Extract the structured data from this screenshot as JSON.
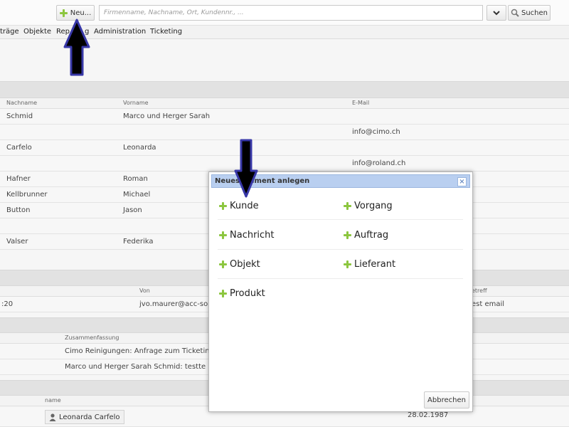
{
  "toolbar": {
    "new_label": "Neu...",
    "search_placeholder": "Firmenname, Nachname, Ort, Kundennr., ...",
    "search_label": "Suchen"
  },
  "menu": {
    "items": [
      "träge",
      "Objekte",
      "Rep",
      "g",
      "Administration",
      "Ticketing"
    ]
  },
  "customers": {
    "headers": {
      "nachname": "Nachname",
      "vorname": "Vorname",
      "email": "E-Mail"
    },
    "rows": [
      {
        "nachname": "Schmid",
        "vorname": "Marco und Herger Sarah",
        "email": ""
      },
      {
        "nachname": "",
        "vorname": "",
        "email": "info@cimo.ch"
      },
      {
        "nachname": "Carfelo",
        "vorname": "Leonarda",
        "email": ""
      },
      {
        "nachname": "",
        "vorname": "",
        "email": "info@roland.ch"
      },
      {
        "nachname": "Hafner",
        "vorname": "Roman",
        "email": ""
      },
      {
        "nachname": "Kellbrunner",
        "vorname": "Michael",
        "email": ""
      },
      {
        "nachname": "Button",
        "vorname": "Jason",
        "email": ""
      },
      {
        "nachname": "",
        "vorname": "",
        "email": ""
      },
      {
        "nachname": "Valser",
        "vorname": "Federika",
        "email": ""
      }
    ]
  },
  "emails": {
    "headers": {
      "von": "Von",
      "betreff": "etreff"
    },
    "row": {
      "time": ":20",
      "von": "jvo.maurer@acc-sol",
      "betreff": "est email"
    }
  },
  "summary": {
    "header": "Zusammenfassung",
    "rows": [
      "Cimo Reinigungen: Anfrage zum Ticketing",
      "Marco und Herger Sarah Schmid: testte"
    ]
  },
  "people": {
    "header": "name",
    "row": {
      "name": "Leonarda Carfelo",
      "date": "28.02.1987"
    }
  },
  "dialog": {
    "title": "Neues Element anlegen",
    "items": {
      "kunde": "Kunde",
      "vorgang": "Vorgang",
      "nachricht": "Nachricht",
      "auftrag": "Auftrag",
      "objekt": "Objekt",
      "lieferant": "Lieferant",
      "produkt": "Produkt"
    },
    "close_label": "×",
    "cancel_label": "Abbrechen"
  },
  "colors": {
    "accent_green": "#8cc63f",
    "dialog_header": "#b9cff0",
    "arrow_fill": "#000000",
    "arrow_outline": "#3838a8"
  }
}
